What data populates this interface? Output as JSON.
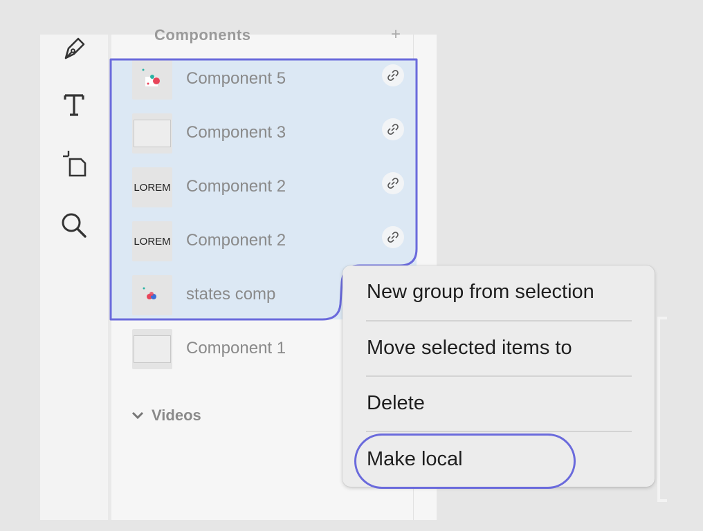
{
  "toolbar": {
    "tools": [
      {
        "name": "pen-icon"
      },
      {
        "name": "text-icon",
        "glyph": "T"
      },
      {
        "name": "artboard-icon"
      },
      {
        "name": "zoom-icon"
      }
    ]
  },
  "panel": {
    "section_title": "Components",
    "add_label": "+",
    "components": [
      {
        "label": "Component 5",
        "thumb": "graphic",
        "linked": true
      },
      {
        "label": "Component 3",
        "thumb": "box",
        "linked": true
      },
      {
        "label": "Component 2",
        "thumb": "LOREM",
        "linked": true
      },
      {
        "label": "Component 2",
        "thumb": "LOREM",
        "linked": true
      },
      {
        "label": "states comp",
        "thumb": "dots",
        "linked": false
      },
      {
        "label": "Component 1",
        "thumb": "box",
        "linked": false
      }
    ],
    "videos_label": "Videos"
  },
  "context_menu": {
    "items": [
      {
        "label": "New group from selection"
      },
      {
        "label": "Move selected items to"
      },
      {
        "label": "Delete"
      },
      {
        "label": "Make local"
      }
    ]
  },
  "colors": {
    "selection_fill": "#dce8f4",
    "highlight_outline": "#6a6adc"
  }
}
